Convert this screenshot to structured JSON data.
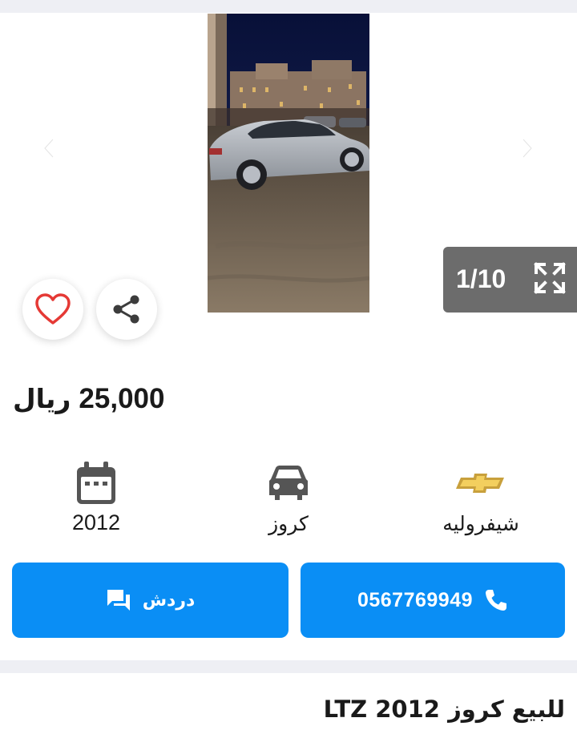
{
  "gallery": {
    "counter": "1/10",
    "prev_icon": "chevron-left-icon",
    "next_icon": "chevron-right-icon",
    "fullscreen_icon": "expand-icon",
    "favorite_icon": "heart-icon",
    "share_icon": "share-icon"
  },
  "listing": {
    "price": "25,000",
    "currency": "ريال",
    "title": "للبيع كروز 2012 LTZ"
  },
  "specs": {
    "brand": "شيفروليه",
    "model": "كروز",
    "year": "2012"
  },
  "actions": {
    "call_number": "0567769949",
    "chat_label": "دردش"
  },
  "colors": {
    "primary_button": "#0a8ef5",
    "favorite_heart": "#e53935",
    "counter_overlay": "#6c6c6c",
    "background_band": "#eeeff4"
  }
}
